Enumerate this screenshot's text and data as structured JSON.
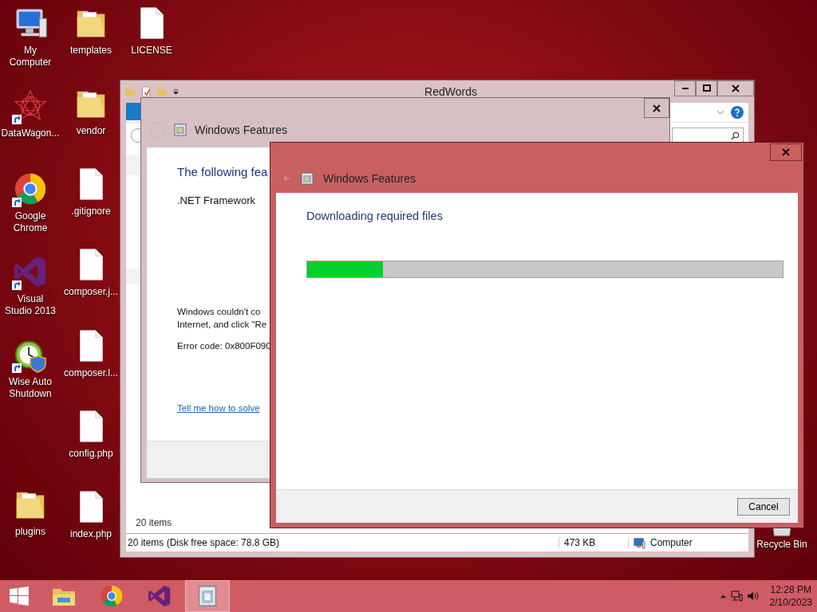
{
  "icon_columns": [
    [
      {
        "label": "My Computer",
        "kind": "computer",
        "shortcut": false
      },
      {
        "label": "DataWagon...",
        "kind": "star",
        "shortcut": true
      },
      {
        "label": "Google Chrome",
        "kind": "browser",
        "shortcut": true
      },
      {
        "label": "Visual Studio 2013",
        "kind": "vs",
        "shortcut": true
      },
      {
        "label": "Wise Auto Shutdown",
        "kind": "clock",
        "shortcut": true
      },
      {
        "label": "plugins",
        "kind": "folder",
        "shortcut": false
      }
    ],
    [
      {
        "label": "templates",
        "kind": "folder",
        "shortcut": false
      },
      {
        "label": "vendor",
        "kind": "folder",
        "shortcut": false
      },
      {
        "label": ".gitignore",
        "kind": "file",
        "shortcut": false
      },
      {
        "label": "composer.j...",
        "kind": "file",
        "shortcut": false
      },
      {
        "label": "composer.l...",
        "kind": "file",
        "shortcut": false
      },
      {
        "label": "config.php",
        "kind": "file",
        "shortcut": false
      },
      {
        "label": "index.php",
        "kind": "file",
        "shortcut": false
      }
    ],
    [
      {
        "label": "LICENSE",
        "kind": "file",
        "shortcut": false
      }
    ]
  ],
  "recycle_bin": {
    "label": "Recycle Bin"
  },
  "explorer": {
    "title": "RedWords",
    "item_count": "20 items",
    "status_bar": {
      "summary": "20 items (Disk free space: 78.8 GB)",
      "size": "473 KB",
      "location": "Computer"
    }
  },
  "error_dialog": {
    "title": "Windows Features",
    "heading": "The following fea",
    "feature": ".NET Framework",
    "message_lines": [
      "Windows couldn't co",
      "Internet, and click \"Re"
    ],
    "error_code": "Error code: 0x800F090",
    "help_link": "Tell me how to solve"
  },
  "progress_dialog": {
    "title": "Windows Features",
    "heading": "Downloading required files",
    "progress": {
      "level": 0.16
    },
    "buttons": [
      "Cancel"
    ]
  },
  "taskbar": {
    "apps": [
      {
        "kind": "start",
        "selected": false
      },
      {
        "kind": "explorer",
        "selected": false
      },
      {
        "kind": "browser",
        "selected": false
      },
      {
        "kind": "vs",
        "selected": false
      },
      {
        "kind": "features",
        "selected": true
      }
    ],
    "clock": {
      "time": "12:28 PM",
      "date": "2/10/2023"
    }
  }
}
